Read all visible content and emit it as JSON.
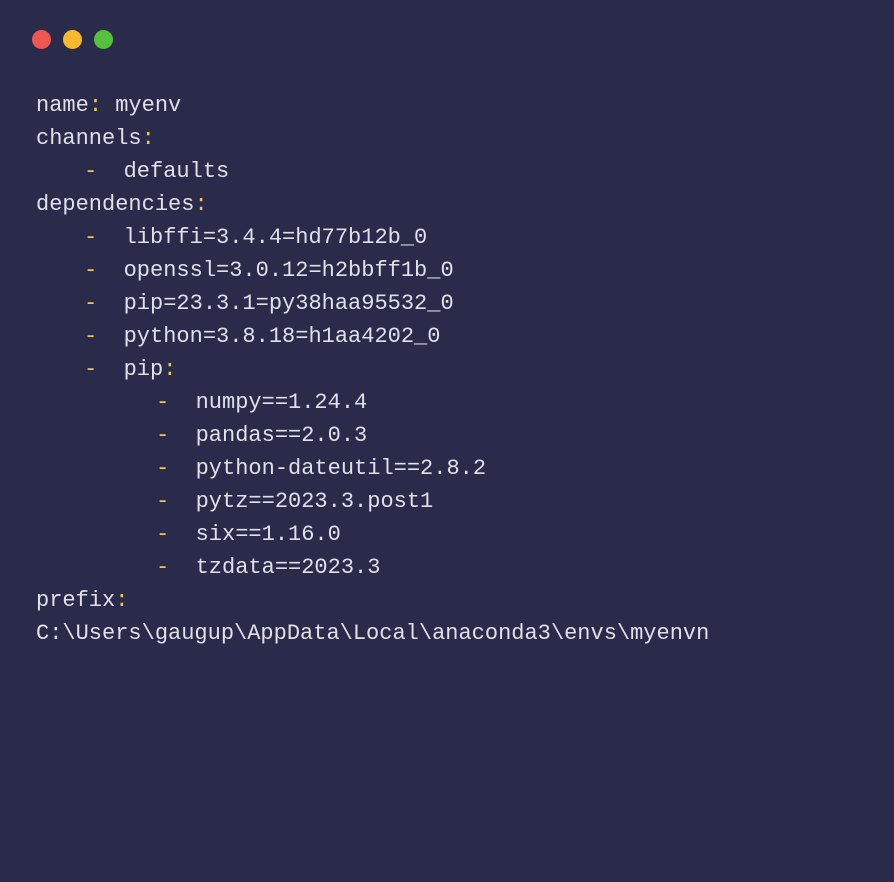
{
  "yaml": {
    "name_key": "name",
    "name_value": "myenv",
    "channels_key": "channels",
    "channels": [
      "defaults"
    ],
    "dependencies_key": "dependencies",
    "dependencies": [
      "libffi=3.4.4=hd77b12b_0",
      "openssl=3.0.12=h2bbff1b_0",
      "pip=23.3.1=py38haa95532_0",
      "python=3.8.18=h1aa4202_0"
    ],
    "pip_key": "pip",
    "pip_deps": [
      "numpy==1.24.4",
      "pandas==2.0.3",
      "python-dateutil==2.8.2",
      "pytz==2023.3.post1",
      "six==1.16.0",
      "tzdata==2023.3"
    ],
    "prefix_key": "prefix",
    "prefix_value": "C:\\Users\\gaugup\\AppData\\Local\\anaconda3\\envs\\myenvn"
  }
}
